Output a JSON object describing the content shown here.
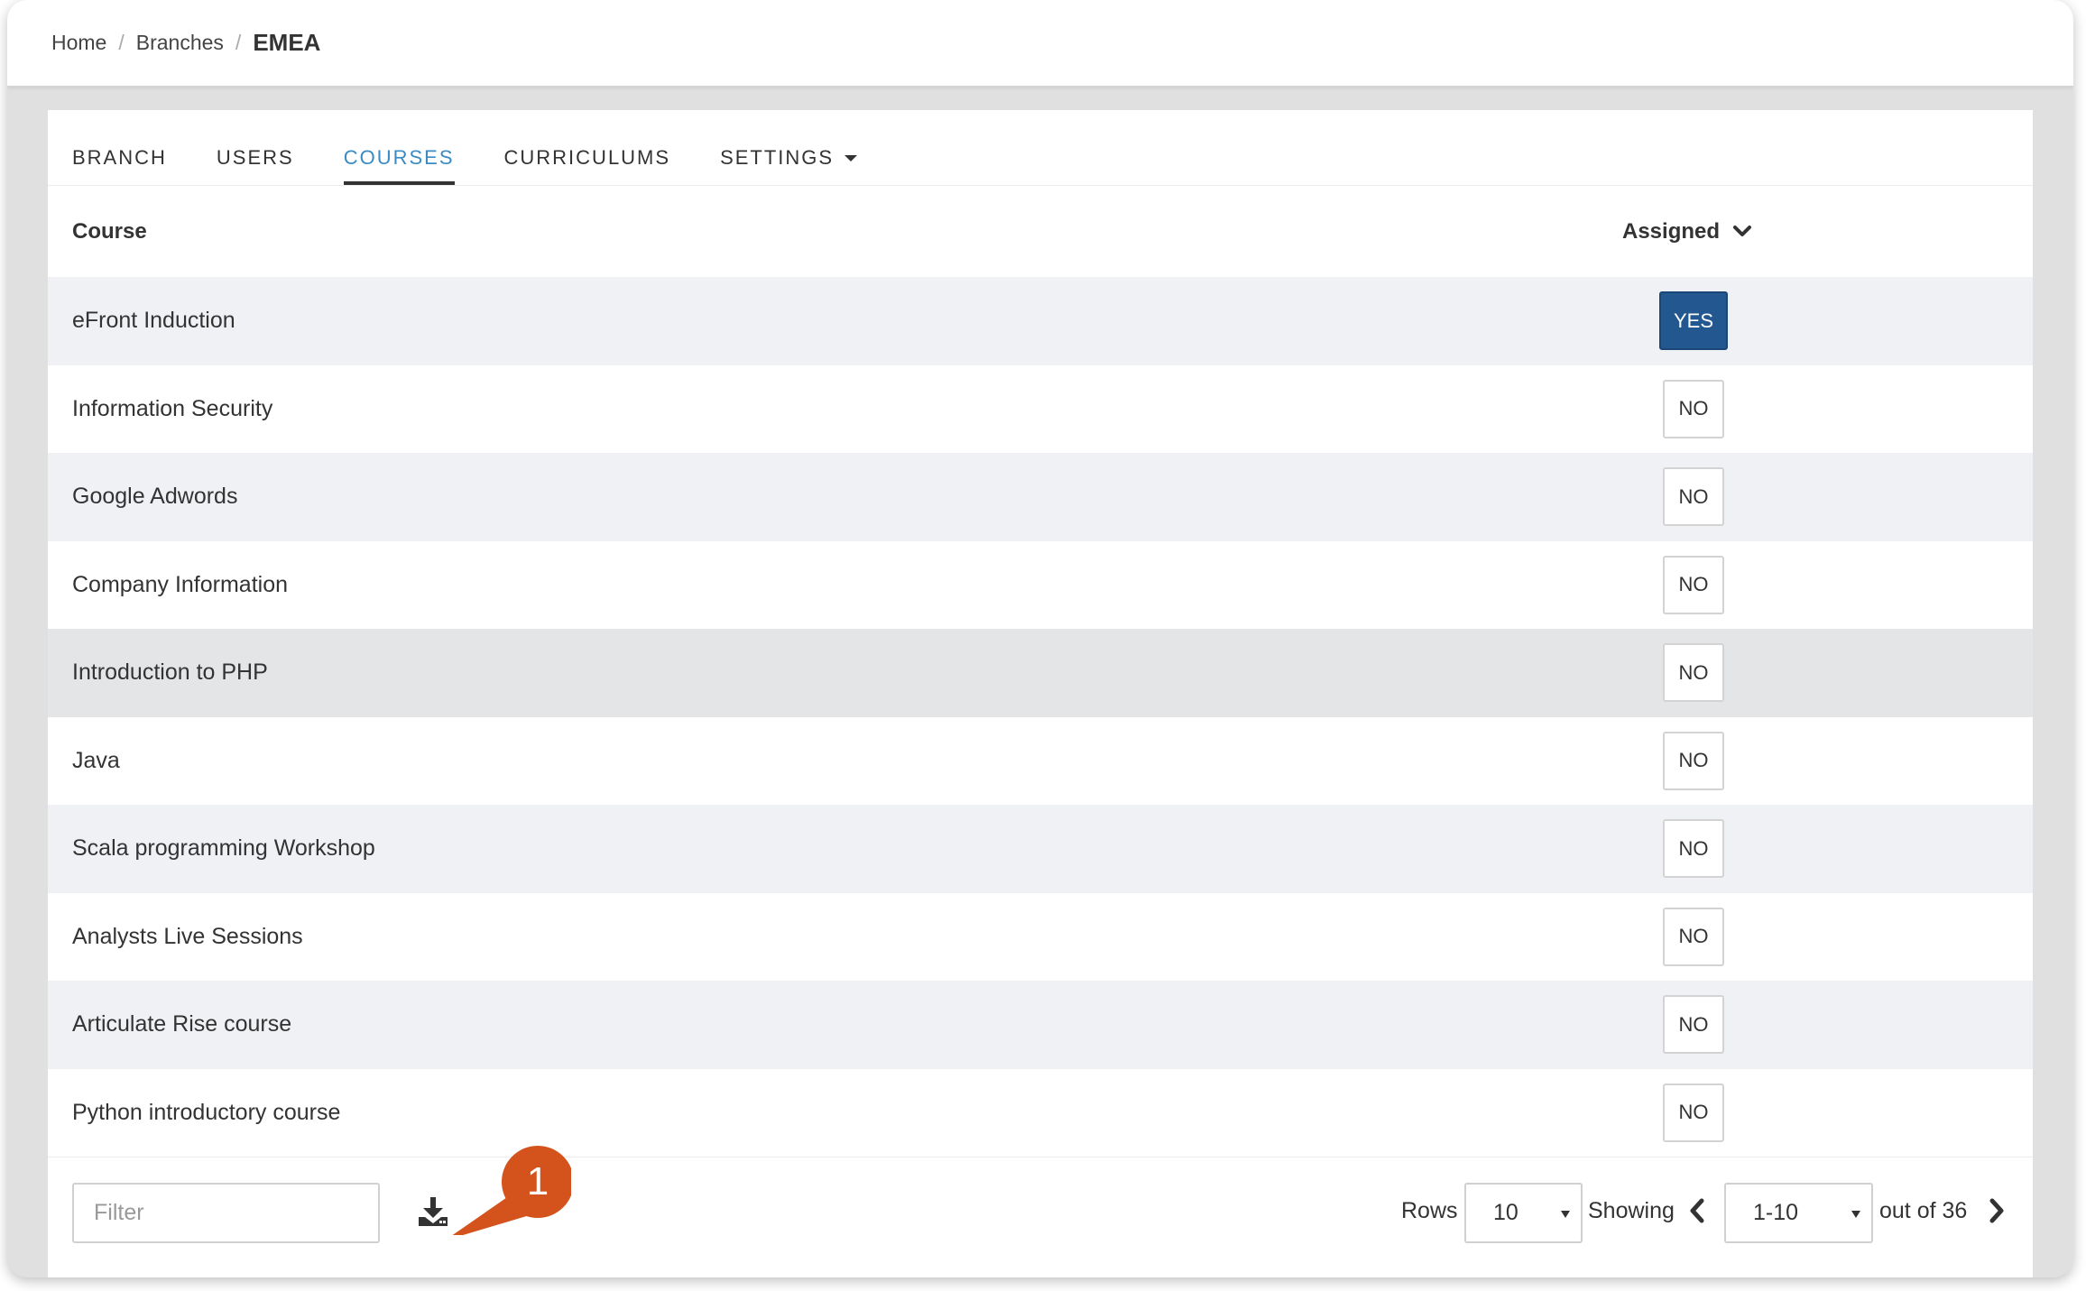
{
  "breadcrumb": {
    "items": [
      "Home",
      "Branches"
    ],
    "current": "EMEA",
    "separator": "/"
  },
  "tabs": [
    {
      "label": "BRANCH",
      "active": false
    },
    {
      "label": "USERS",
      "active": false
    },
    {
      "label": "COURSES",
      "active": true
    },
    {
      "label": "CURRICULUMS",
      "active": false
    },
    {
      "label": "SETTINGS",
      "active": false,
      "has_dropdown": true
    }
  ],
  "table": {
    "columns": {
      "course": "Course",
      "assigned": "Assigned"
    },
    "sort_icon": "chevron-down-icon",
    "rows": [
      {
        "name": "eFront Induction",
        "assigned": "YES"
      },
      {
        "name": "Information Security",
        "assigned": "NO"
      },
      {
        "name": "Google Adwords",
        "assigned": "NO"
      },
      {
        "name": "Company Information",
        "assigned": "NO"
      },
      {
        "name": "Introduction to PHP",
        "assigned": "NO"
      },
      {
        "name": "Java",
        "assigned": "NO"
      },
      {
        "name": "Scala programming Workshop",
        "assigned": "NO"
      },
      {
        "name": "Analysts Live Sessions",
        "assigned": "NO"
      },
      {
        "name": "Articulate Rise course",
        "assigned": "NO"
      },
      {
        "name": "Python introductory course",
        "assigned": "NO"
      }
    ]
  },
  "footer": {
    "filter_placeholder": "Filter",
    "download_icon": "download-icon",
    "rows_label": "Rows",
    "rows_value": "10",
    "showing_label": "Showing",
    "page_range": "1-10",
    "out_of_label": "out of 36"
  },
  "callout": {
    "number": "1",
    "color": "#d4531c"
  },
  "colors": {
    "active_tab": "#3a8bc4",
    "yes_button": "#23578f",
    "row_stripe": "#eff1f4"
  }
}
